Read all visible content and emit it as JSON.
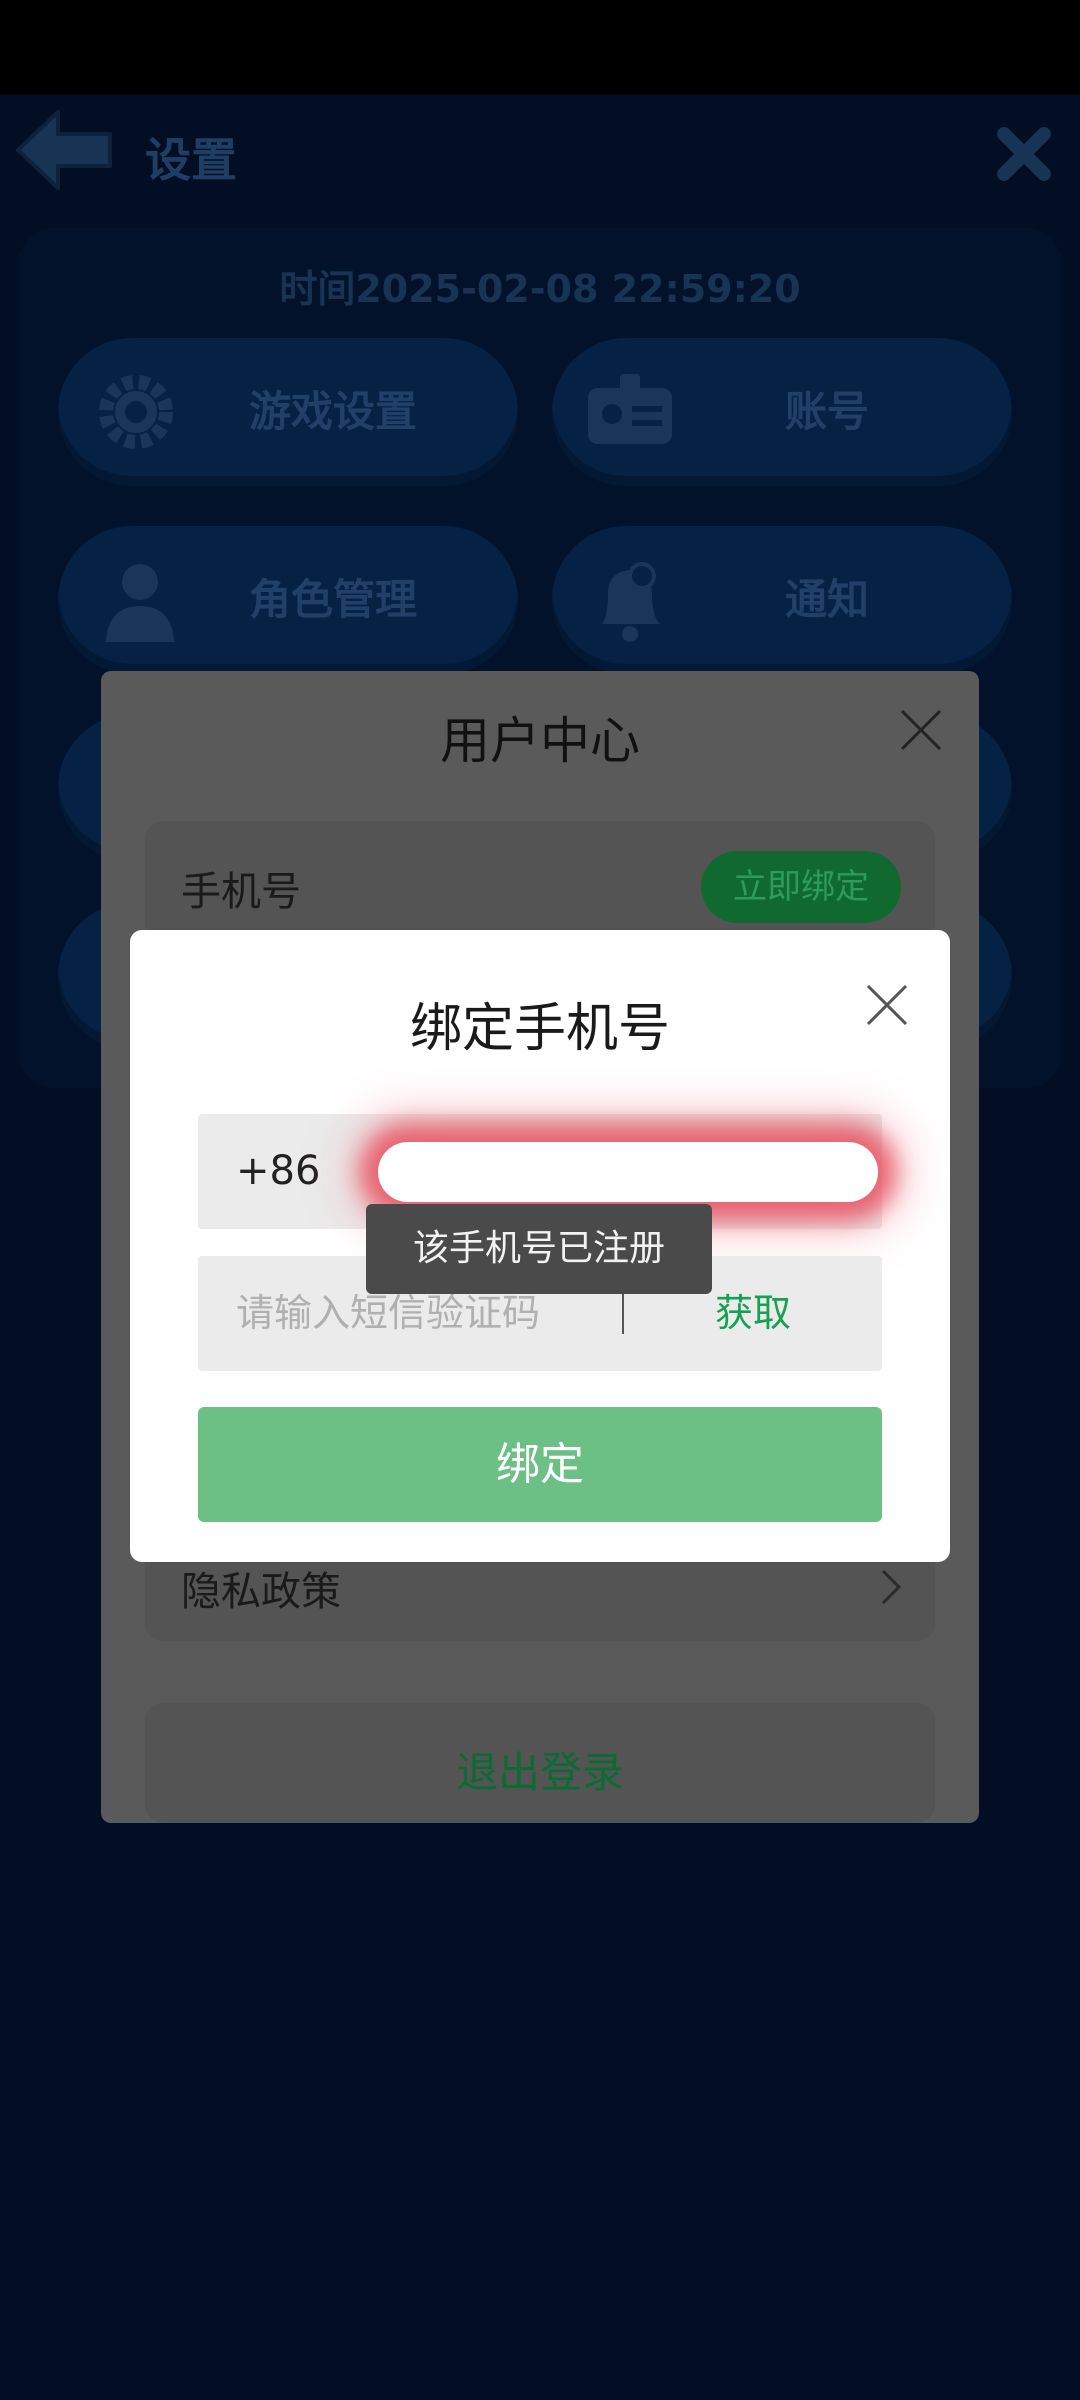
{
  "game": {
    "header_title": "设置",
    "time_text": "时间2025-02-08 22:59:20",
    "buttons": [
      {
        "label": "游戏设置",
        "icon": "gear-icon"
      },
      {
        "label": "账号",
        "icon": "id-card-icon"
      },
      {
        "label": "角色管理",
        "icon": "person-icon"
      },
      {
        "label": "通知",
        "icon": "bell-icon"
      }
    ]
  },
  "user_center": {
    "title": "用户中心",
    "phone_label": "手机号",
    "bind_now": "立即绑定",
    "privacy": "隐私政策",
    "logout": "退出登录"
  },
  "bind_dialog": {
    "title": "绑定手机号",
    "country_code": "+86",
    "sms_placeholder": "请输入短信验证码",
    "get_code": "获取",
    "submit": "绑定"
  },
  "toast": "该手机号已注册",
  "colors": {
    "accent_green": "#16a052",
    "submit_green": "#6cbf85",
    "game_blue": "#0a3d7c"
  }
}
